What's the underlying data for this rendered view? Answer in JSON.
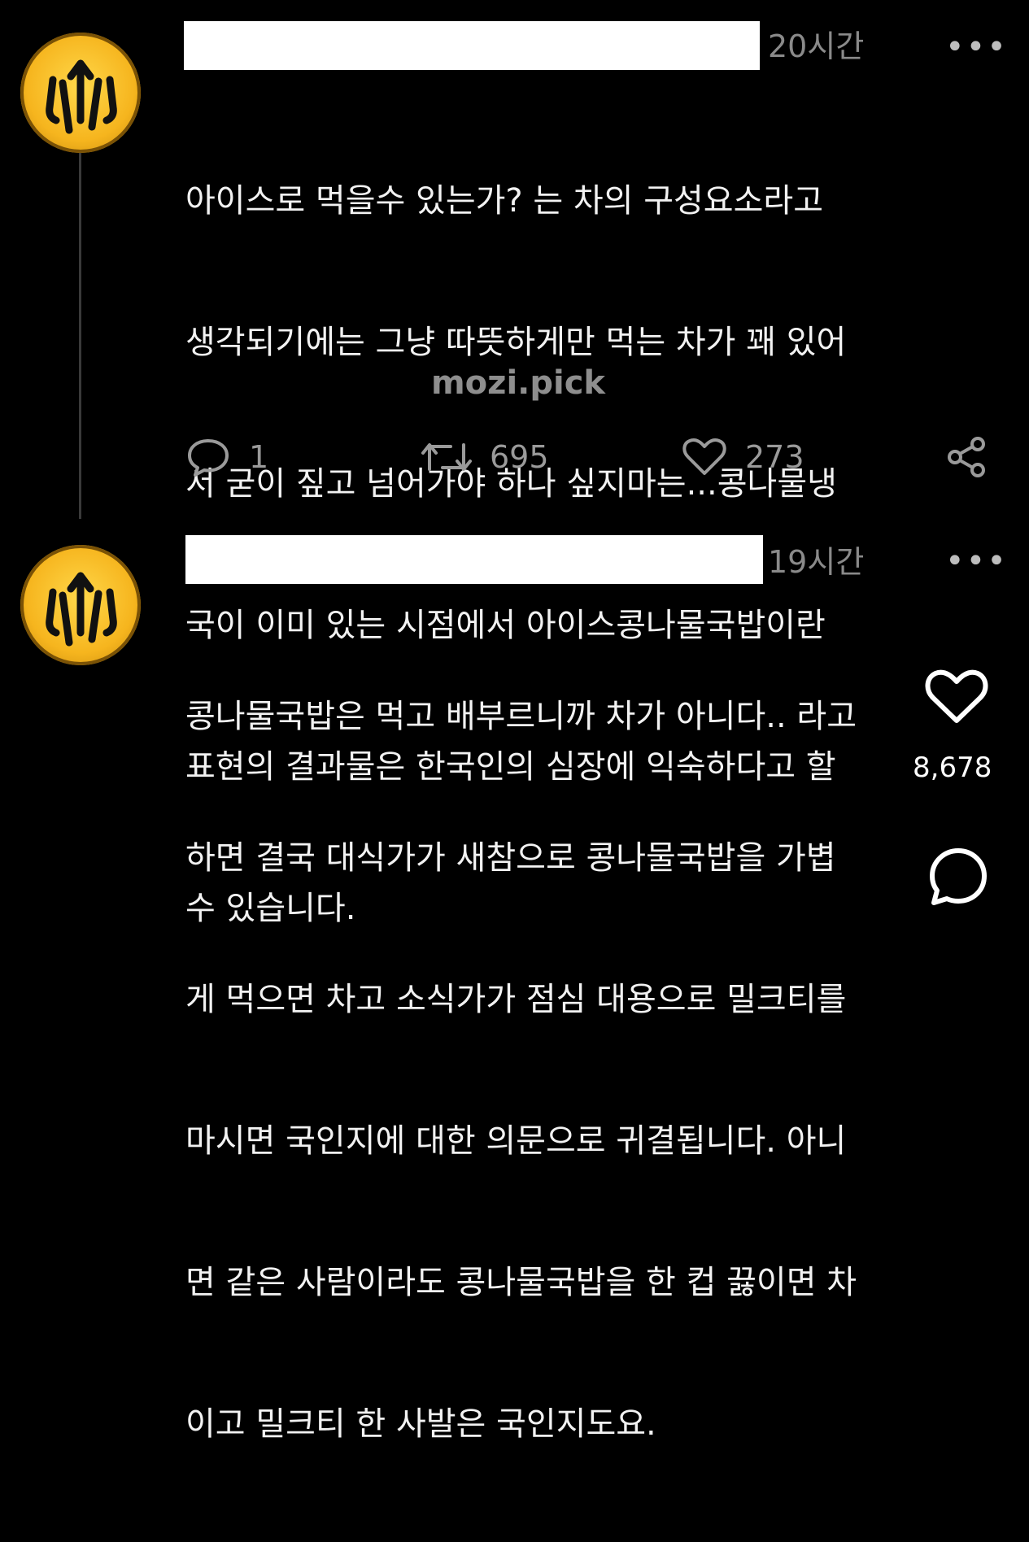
{
  "watermark": "mozi.pick",
  "replies": [
    {
      "timestamp": "20시간",
      "more": "•••",
      "lines": [
        "아이스로 먹을수 있는가? 는 차의 구성요소라고",
        "생각되기에는 그냥 따뜻하게만 먹는 차가 꽤 있어",
        "서 굳이 짚고 넘어가야 하나 싶지마는...콩나물냉",
        "국이 이미 있는 시점에서 아이스콩나물국밥이란",
        "표현의 결과물은 한국인의 심장에 익숙하다고 할",
        "수 있습니다."
      ],
      "replies_count": "1",
      "reposts_count": "695",
      "likes_count": "273"
    },
    {
      "timestamp": "19시간",
      "more": "•••",
      "lines": [
        "콩나물국밥은 먹고 배부르니까 차가 아니다.. 라고",
        "하면 결국 대식가가 새참으로 콩나물국밥을 가볍",
        "게 먹으면 차고 소식가가 점심 대용으로 밀크티를",
        "마시면 국인지에 대한 의문으로 귀결됩니다. 아니",
        "면 같은 사람이라도 콩나물국밥을 한 컵 끓이면 차",
        "이고 밀크티 한 사발은 국인지도요."
      ]
    }
  ],
  "overlay": {
    "like_count": "8,678"
  },
  "colors": {
    "background": "#000000",
    "text": "#f2f2f2",
    "muted": "#8a8a8a",
    "avatar": "#f6b51e"
  }
}
